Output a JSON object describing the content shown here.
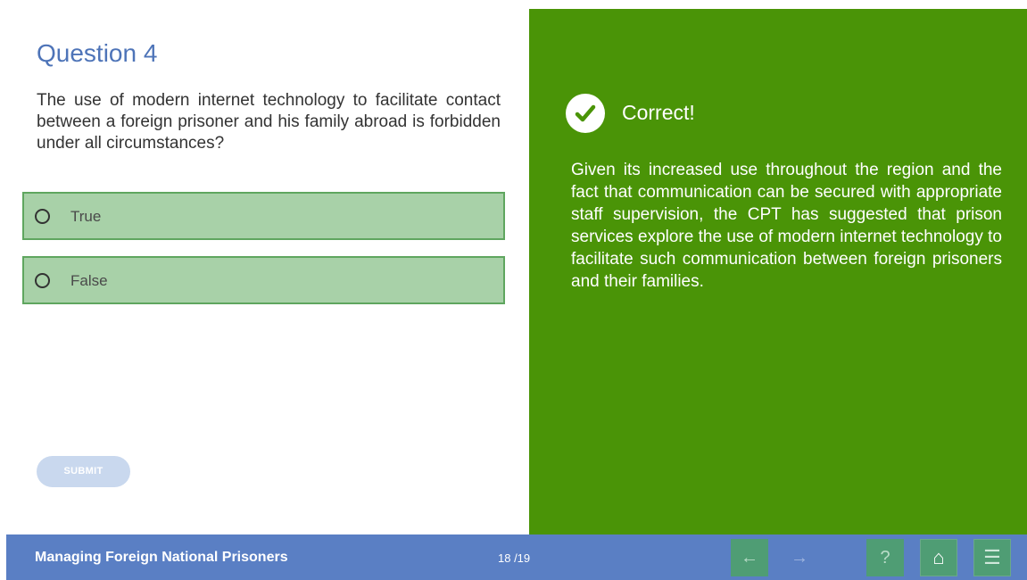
{
  "question": {
    "title": "Question 4",
    "text": "The use of modern internet technology to facilitate contact between a foreign prisoner and his family abroad is forbidden under all circumstances?",
    "options": [
      {
        "label": "True"
      },
      {
        "label": "False"
      }
    ],
    "submit_label": "SUBMIT"
  },
  "feedback": {
    "title": "Correct!",
    "text": "Given its increased use throughout the region and the fact that communication can be secured with appropriate staff supervision, the CPT has suggested that prison services explore the use of modern internet technology to facilitate such communication between foreign prisoners and their families.",
    "icon": "check-circle-icon",
    "color": "#4a9407"
  },
  "footer": {
    "course_title": "Managing Foreign National Prisoners",
    "page_indicator": "18 /19",
    "buttons": {
      "prev": {
        "icon": "arrow-left-icon",
        "glyph": "←"
      },
      "next": {
        "icon": "arrow-right-icon",
        "glyph": "→"
      },
      "help": {
        "icon": "question-icon",
        "glyph": "?"
      },
      "home": {
        "icon": "home-icon",
        "glyph": "⌂"
      },
      "menu": {
        "icon": "menu-icon",
        "glyph": "☰"
      }
    },
    "color": "#5a7fc4"
  }
}
